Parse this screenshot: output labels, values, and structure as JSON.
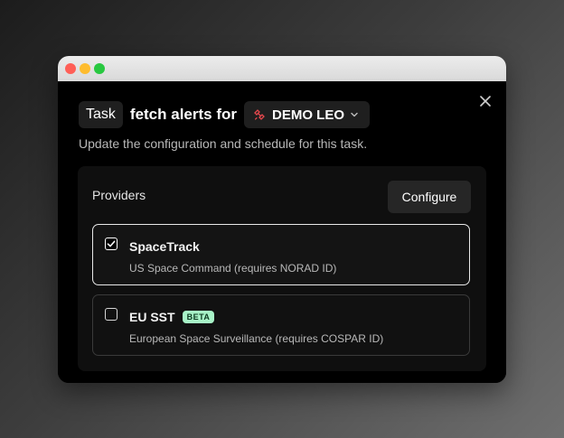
{
  "dialog": {
    "task_chip": "Task",
    "heading_text": "fetch alerts for",
    "satellite": "DEMO LEO",
    "subtitle": "Update the configuration and schedule for this task."
  },
  "providers": {
    "title": "Providers",
    "configure_label": "Configure",
    "items": [
      {
        "name": "SpaceTrack",
        "description": "US Space Command (requires NORAD ID)",
        "checked": true,
        "badge": ""
      },
      {
        "name": "EU SST",
        "description": "European Space Surveillance (requires COSPAR ID)",
        "checked": false,
        "badge": "BETA"
      }
    ]
  },
  "icons": {
    "close": "close-icon",
    "satellite": "satellite-icon",
    "chevron": "chevron-down-icon",
    "check": "check-icon"
  },
  "colors": {
    "satellite_icon": "#e5484d",
    "beta_badge_bg": "#a7f3c7",
    "selected_border": "#e9e9e9"
  }
}
